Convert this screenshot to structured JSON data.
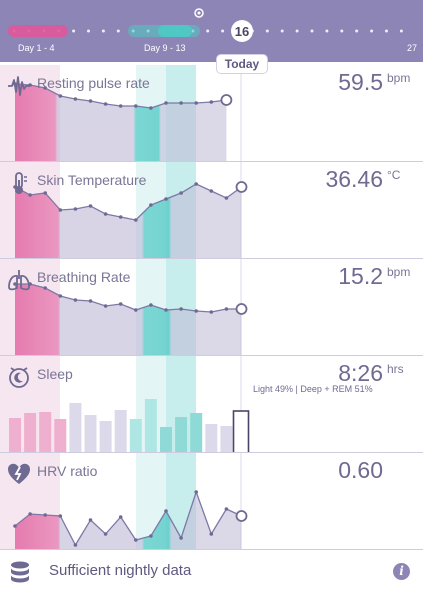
{
  "timeline": {
    "phase1_label": "Day 1 - 4",
    "phase2_label": "Day 9 - 13",
    "current_day": "16",
    "last_day": "27",
    "today_label": "Today",
    "colors": {
      "menstrual": "#e0579a",
      "fertile": "#4ec9c3",
      "background": "#8c85b6"
    }
  },
  "metrics": [
    {
      "id": "resting-pulse",
      "title": "Resting pulse rate",
      "value": "59.5",
      "unit": "bpm",
      "icon": "pulse-wave-icon",
      "series": [
        78,
        77,
        74,
        66,
        63,
        61,
        58,
        56,
        56,
        54,
        59,
        59,
        59,
        60,
        62
      ]
    },
    {
      "id": "skin-temp",
      "title": "Skin Temperature",
      "value": "36.46",
      "unit": "°C",
      "icon": "thermometer-icon",
      "series": [
        72,
        64,
        66,
        49,
        50,
        53,
        45,
        42,
        39,
        54,
        60,
        66,
        75,
        68,
        61,
        72
      ]
    },
    {
      "id": "breathing",
      "title": "Breathing Rate",
      "value": "15.2",
      "unit": "bpm",
      "icon": "lungs-icon",
      "series": [
        72,
        72,
        68,
        60,
        56,
        55,
        50,
        52,
        46,
        51,
        46,
        47,
        45,
        44,
        47,
        47
      ]
    },
    {
      "id": "sleep",
      "title": "Sleep",
      "value": "8:26",
      "unit": "hrs",
      "icon": "moon-alarm-icon",
      "subtitle": "Light 49% | Deep + REM 51%",
      "bars": [
        35,
        40,
        41,
        34,
        50,
        38,
        32,
        43,
        34,
        54,
        26,
        36,
        40,
        29,
        27,
        42
      ]
    },
    {
      "id": "hrv",
      "title": "HRV ratio",
      "value": "0.60",
      "unit": "",
      "icon": "heart-bolt-icon",
      "series": [
        24,
        36,
        35,
        34,
        5,
        30,
        16,
        33,
        10,
        14,
        39,
        12,
        58,
        16,
        41,
        34
      ]
    }
  ],
  "footer": {
    "label": "Sufficient nightly data",
    "icon": "database-icon",
    "info_icon": "info-icon"
  }
}
